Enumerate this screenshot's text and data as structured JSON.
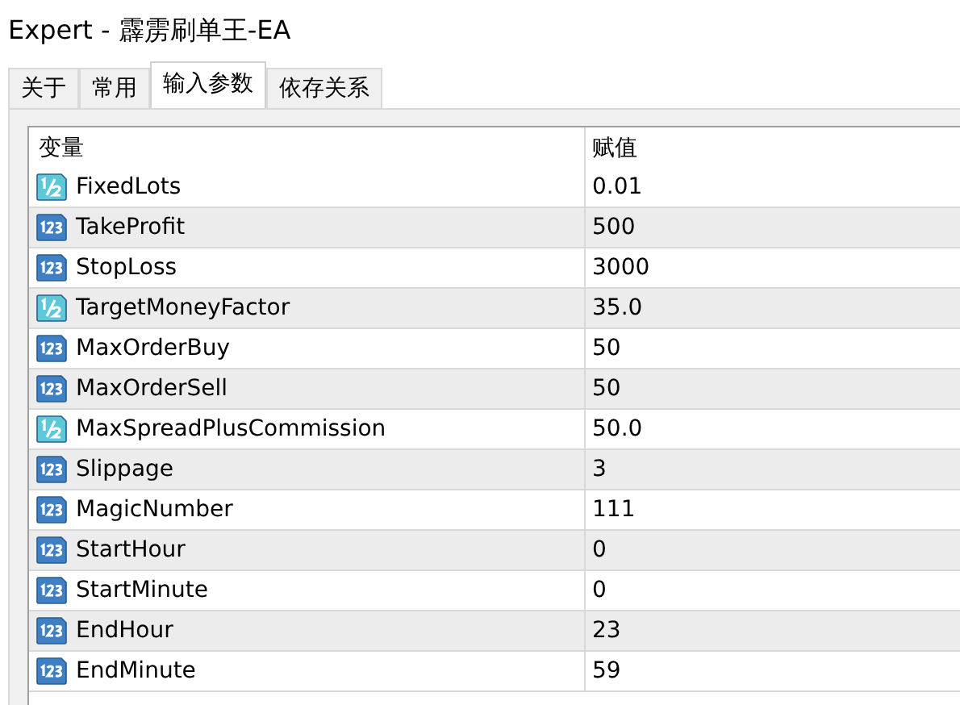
{
  "window": {
    "title": "Expert - 霹雳刷单王-EA"
  },
  "tabs": [
    {
      "label": "关于",
      "selected": false
    },
    {
      "label": "常用",
      "selected": false
    },
    {
      "label": "输入参数",
      "selected": true
    },
    {
      "label": "依存关系",
      "selected": false
    }
  ],
  "table": {
    "columns": [
      "变量",
      "赋值"
    ],
    "rows": [
      {
        "kind": "double",
        "name": "FixedLots",
        "value": "0.01"
      },
      {
        "kind": "int",
        "name": "TakeProfit",
        "value": "500"
      },
      {
        "kind": "int",
        "name": "StopLoss",
        "value": "3000"
      },
      {
        "kind": "double",
        "name": "TargetMoneyFactor",
        "value": "35.0"
      },
      {
        "kind": "int",
        "name": "MaxOrderBuy",
        "value": "50"
      },
      {
        "kind": "int",
        "name": "MaxOrderSell",
        "value": "50"
      },
      {
        "kind": "double",
        "name": "MaxSpreadPlusCommission",
        "value": "50.0"
      },
      {
        "kind": "int",
        "name": "Slippage",
        "value": "3"
      },
      {
        "kind": "int",
        "name": "MagicNumber",
        "value": "111"
      },
      {
        "kind": "int",
        "name": "StartHour",
        "value": "0"
      },
      {
        "kind": "int",
        "name": "StartMinute",
        "value": "0"
      },
      {
        "kind": "int",
        "name": "EndHour",
        "value": "23"
      },
      {
        "kind": "int",
        "name": "EndMinute",
        "value": "59"
      }
    ]
  }
}
